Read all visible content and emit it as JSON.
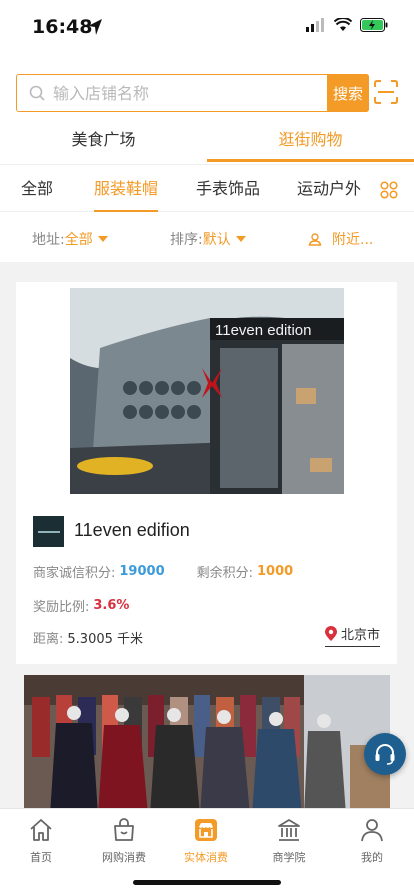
{
  "status_bar": {
    "time": "16:48"
  },
  "search": {
    "placeholder": "输入店铺名称",
    "button_label": "搜索"
  },
  "main_tabs": [
    {
      "label": "美食广场",
      "active": false
    },
    {
      "label": "逛街购物",
      "active": true
    }
  ],
  "categories": [
    {
      "label": "全部",
      "active": false
    },
    {
      "label": "服装鞋帽",
      "active": true
    },
    {
      "label": "手表饰品",
      "active": false
    },
    {
      "label": "运动户外",
      "active": false
    }
  ],
  "filters": {
    "address_label": "地址:",
    "address_value": "全部",
    "sort_label": "排序:",
    "sort_value": "默认",
    "nearby_label": "附近..."
  },
  "shops": [
    {
      "photo_sign": "11even edition",
      "name": "11even edifion",
      "credit_label": "商家诚信积分:",
      "credit_value": "19000",
      "remain_label": "剩余积分:",
      "remain_value": "1000",
      "reward_label": "奖励比例:",
      "reward_value": "3.6%",
      "distance_label": "距离:",
      "distance_value": "5.3005 千米",
      "city": "北京市"
    }
  ],
  "tab_bar": [
    {
      "label": "首页",
      "icon": "home-icon",
      "active": false
    },
    {
      "label": "网购消费",
      "icon": "shopping-bag-icon",
      "active": false
    },
    {
      "label": "实体消费",
      "icon": "store-icon",
      "active": true
    },
    {
      "label": "商学院",
      "icon": "school-icon",
      "active": false
    },
    {
      "label": "我的",
      "icon": "user-icon",
      "active": false
    }
  ],
  "colors": {
    "accent": "#f39a27",
    "blue": "#3b9ad9",
    "red": "#d9303e"
  }
}
